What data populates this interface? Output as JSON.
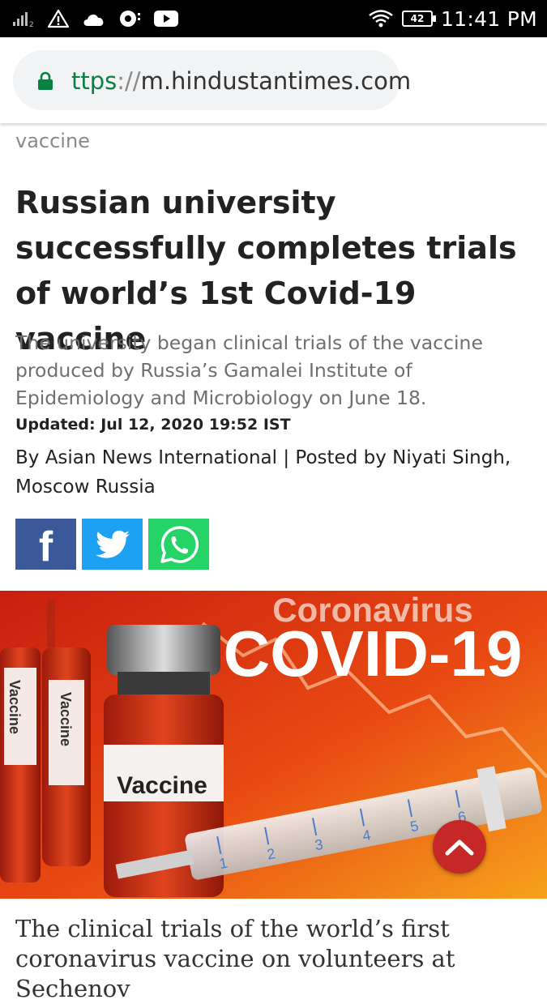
{
  "status_bar": {
    "time": "11:41 PM",
    "battery": "42",
    "icons": [
      "signal-icon",
      "warning-icon",
      "cloud-icon",
      "media-icon",
      "youtube-icon",
      "wifi-icon",
      "battery-icon"
    ]
  },
  "browser": {
    "url_scheme": "ttps",
    "url_separator": "://",
    "url_host": "m.hindustantimes.com"
  },
  "article": {
    "breadcrumb": "vaccine",
    "headline": "Russian university successfully completes trials of world’s 1st Covid-19 vaccine",
    "summary": "The university began clinical trials of the vaccine produced by Russia’s Gamalei Institute of Epidemiology and Microbiology on June 18.",
    "updated": "Updated: Jul 12, 2020 19:52 IST",
    "byline": "By Asian News International | Posted by Niyati Singh, Moscow Russia",
    "share": {
      "facebook_glyph": "f",
      "brand_colors": {
        "facebook": "#3b5998",
        "twitter": "#1da1f2",
        "whatsapp": "#25d366"
      }
    },
    "image": {
      "overlay_top": "Coronavirus",
      "overlay_main": "COVID-19",
      "vial_label": "Vaccine",
      "ampoule_labels": [
        "Vaccine",
        "Vaccine"
      ],
      "syringe_numbers": [
        "1",
        "2",
        "3",
        "4",
        "5",
        "6"
      ]
    },
    "caption": "The clinical trials of the world’s first coronavirus vaccine on volunteers at Sechenov"
  },
  "colors": {
    "accent_red": "#c62828",
    "url_green": "#0b8043"
  }
}
